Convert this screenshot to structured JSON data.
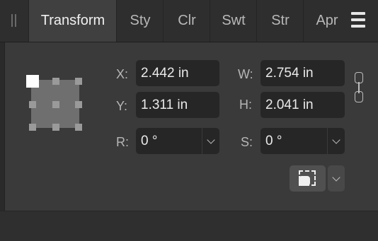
{
  "tabs": [
    {
      "label": "Transform",
      "active": true
    },
    {
      "label": "Sty",
      "active": false
    },
    {
      "label": "Clr",
      "active": false
    },
    {
      "label": "Swt",
      "active": false
    },
    {
      "label": "Str",
      "active": false
    },
    {
      "label": "Apr",
      "active": false
    }
  ],
  "fields": {
    "x": {
      "label": "X:",
      "value": "2.442 in"
    },
    "y": {
      "label": "Y:",
      "value": "1.311 in"
    },
    "w": {
      "label": "W:",
      "value": "2.754 in"
    },
    "h": {
      "label": "H:",
      "value": "2.041 in"
    },
    "r": {
      "label": "R:",
      "value": "0 °"
    },
    "s": {
      "label": "S:",
      "value": "0 °"
    }
  },
  "icons": {
    "panel_grip": "grip-icon",
    "menu": "hamburger-menu-icon",
    "link": "link-aspect-icon",
    "anchor": "anchor-point-selector",
    "transform_origin": "transform-origin-icon",
    "dropdown": "chevron-down-icon"
  },
  "anchor": {
    "selected": "top-left"
  },
  "colors": {
    "panel_bg": "#3a3a3a",
    "field_bg": "#262626",
    "active_tab_bg": "#404040",
    "text": "#eaeaea"
  }
}
